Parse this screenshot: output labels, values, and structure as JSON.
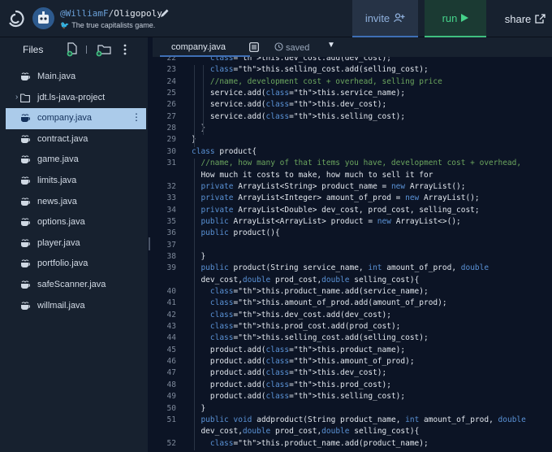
{
  "header": {
    "owner": "@WilliamF",
    "separator": "/",
    "repl_name": "Oligopoly",
    "description": "The true capitalists game.",
    "invite_label": "invite",
    "run_label": "run",
    "share_label": "share"
  },
  "sidebar": {
    "title": "Files",
    "items": [
      {
        "name": "Main.java",
        "type": "file"
      },
      {
        "name": "jdt.ls-java-project",
        "type": "folder"
      },
      {
        "name": "company.java",
        "type": "file",
        "selected": true
      },
      {
        "name": "contract.java",
        "type": "file"
      },
      {
        "name": "game.java",
        "type": "file"
      },
      {
        "name": "limits.java",
        "type": "file"
      },
      {
        "name": "news.java",
        "type": "file"
      },
      {
        "name": "options.java",
        "type": "file"
      },
      {
        "name": "player.java",
        "type": "file"
      },
      {
        "name": "portfolio.java",
        "type": "file"
      },
      {
        "name": "safeScanner.java",
        "type": "file"
      },
      {
        "name": "willmail.java",
        "type": "file"
      }
    ]
  },
  "editor": {
    "tab": "company.java",
    "status": "saved",
    "lines": [
      {
        "n": "22",
        "i": 2,
        "t": "this.dev_cost.add(dev_cost);"
      },
      {
        "n": "23",
        "i": 2,
        "t": "this.selling_cost.add(selling_cost);"
      },
      {
        "n": "24",
        "i": 2,
        "t": "//name, development cost + overhead, selling price"
      },
      {
        "n": "25",
        "i": 2,
        "t": "service.add(this.service_name);"
      },
      {
        "n": "26",
        "i": 2,
        "t": "service.add(this.dev_cost);"
      },
      {
        "n": "27",
        "i": 2,
        "t": "service.add(this.selling_cost);"
      },
      {
        "n": "28",
        "i": 1,
        "t": "}"
      },
      {
        "n": "29",
        "i": 0,
        "t": "}"
      },
      {
        "n": "30",
        "i": 0,
        "t": "class product{"
      },
      {
        "n": "31",
        "i": 1,
        "t": "//name, how many of that items you have, development cost + overhead,"
      },
      {
        "n": "",
        "i": 1,
        "t": "How much it costs to make, how much to sell it for"
      },
      {
        "n": "32",
        "i": 1,
        "t": "private ArrayList<String> product_name = new ArrayList();"
      },
      {
        "n": "33",
        "i": 1,
        "t": "private ArrayList<Integer> amount_of_prod = new ArrayList();"
      },
      {
        "n": "34",
        "i": 1,
        "t": "private ArrayList<Double> dev_cost, prod_cost, selling_cost;"
      },
      {
        "n": "35",
        "i": 1,
        "t": "public ArrayList<ArrayList> product = new ArrayList<>();"
      },
      {
        "n": "36",
        "i": 1,
        "t": "public product(){"
      },
      {
        "n": "37",
        "i": 1,
        "t": ""
      },
      {
        "n": "38",
        "i": 1,
        "t": "}"
      },
      {
        "n": "39",
        "i": 1,
        "t": "public product(String service_name, int amount_of_prod, double"
      },
      {
        "n": "",
        "i": 1,
        "t": "dev_cost,double prod_cost,double selling_cost){"
      },
      {
        "n": "40",
        "i": 2,
        "t": "this.product_name.add(service_name);"
      },
      {
        "n": "41",
        "i": 2,
        "t": "this.amount_of_prod.add(amount_of_prod);"
      },
      {
        "n": "42",
        "i": 2,
        "t": "this.dev_cost.add(dev_cost);"
      },
      {
        "n": "43",
        "i": 2,
        "t": "this.prod_cost.add(prod_cost);"
      },
      {
        "n": "44",
        "i": 2,
        "t": "this.selling_cost.add(selling_cost);"
      },
      {
        "n": "45",
        "i": 2,
        "t": "product.add(this.product_name);"
      },
      {
        "n": "46",
        "i": 2,
        "t": "product.add(this.amount_of_prod);"
      },
      {
        "n": "47",
        "i": 2,
        "t": "product.add(this.dev_cost);"
      },
      {
        "n": "48",
        "i": 2,
        "t": "product.add(this.prod_cost);"
      },
      {
        "n": "49",
        "i": 2,
        "t": "product.add(this.selling_cost);"
      },
      {
        "n": "50",
        "i": 1,
        "t": "}"
      },
      {
        "n": "51",
        "i": 1,
        "t": "public void addproduct(String product_name, int amount_of_prod, double"
      },
      {
        "n": "",
        "i": 1,
        "t": "dev_cost,double prod_cost,double selling_cost){"
      },
      {
        "n": "52",
        "i": 2,
        "t": "this.product_name.add(product_name);"
      }
    ]
  },
  "colors": {
    "keyword": "#5a92d6",
    "comment": "#6ba55e",
    "run_green": "#45d28a",
    "selected_file": "#abcbea"
  }
}
